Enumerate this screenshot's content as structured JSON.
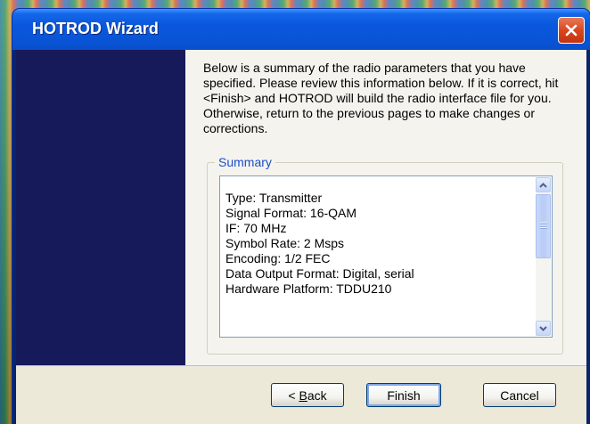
{
  "window": {
    "title": "HOTROD Wizard",
    "close_icon": "close-icon",
    "accent_color": "#0a57dc",
    "close_color": "#d9461f"
  },
  "intro": {
    "text": "Below is a summary of the radio parameters that you have specified.  Please review this information below.  If it is correct, hit <Finish> and HOTROD will build the radio interface file for you.  Otherwise, return to the previous pages to make changes or corrections."
  },
  "summary": {
    "legend": "Summary",
    "lines": [
      "Type:  Transmitter",
      "Signal Format:  16-QAM",
      "IF:  70 MHz",
      "Symbol Rate:  2 Msps",
      "Encoding:  1/2 FEC",
      "Data Output Format:  Digital, serial",
      "Hardware Platform:  TDDU210"
    ],
    "scroll_up_icon": "scroll-up-arrow-icon",
    "scroll_down_icon": "scroll-down-arrow-icon"
  },
  "buttons": {
    "back_prefix": "< ",
    "back_mnemonic": "B",
    "back_rest": "ack",
    "finish": "Finish",
    "cancel": "Cancel"
  }
}
